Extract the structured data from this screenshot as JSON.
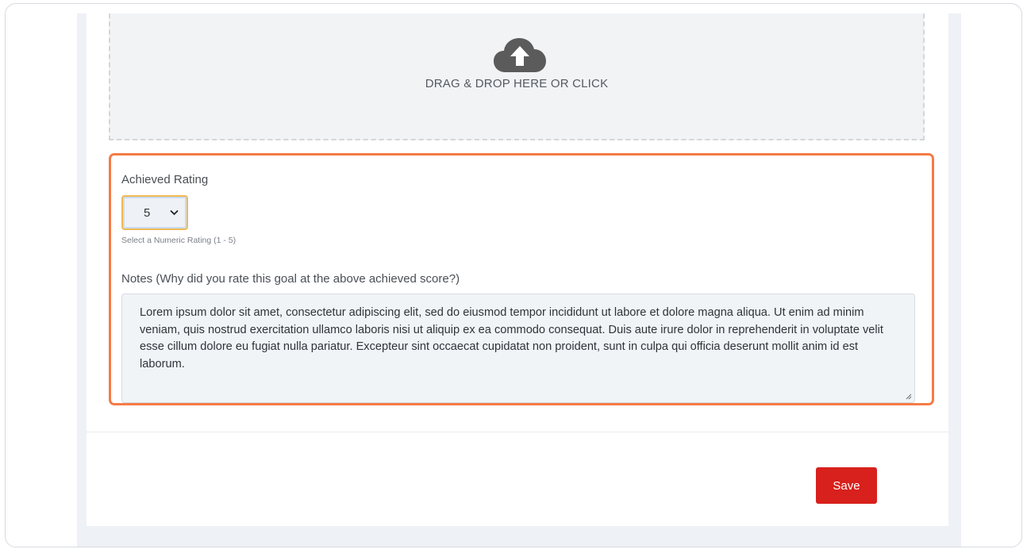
{
  "upload": {
    "icon": "cloud-upload-icon",
    "text": "DRAG & DROP HERE OR CLICK"
  },
  "rating": {
    "label": "Achieved Rating",
    "value": "5",
    "help": "Select a Numeric Rating (1 - 5)"
  },
  "notes": {
    "label": "Notes (Why did you rate this goal at the above achieved score?)",
    "value": "Lorem ipsum dolor sit amet, consectetur adipiscing elit, sed do eiusmod tempor incididunt ut labore et dolore magna aliqua. Ut enim ad minim veniam, quis nostrud exercitation ullamco laboris nisi ut aliquip ex ea commodo consequat. Duis aute irure dolor in reprehenderit in voluptate velit esse cillum dolore eu fugiat nulla pariatur. Excepteur sint occaecat cupidatat non proident, sunt in culpa qui officia deserunt mollit anim id est laborum."
  },
  "actions": {
    "save_label": "Save"
  },
  "colors": {
    "highlight": "#f57b45",
    "save_button": "#d8201c",
    "select_focus": "#f0b955"
  }
}
